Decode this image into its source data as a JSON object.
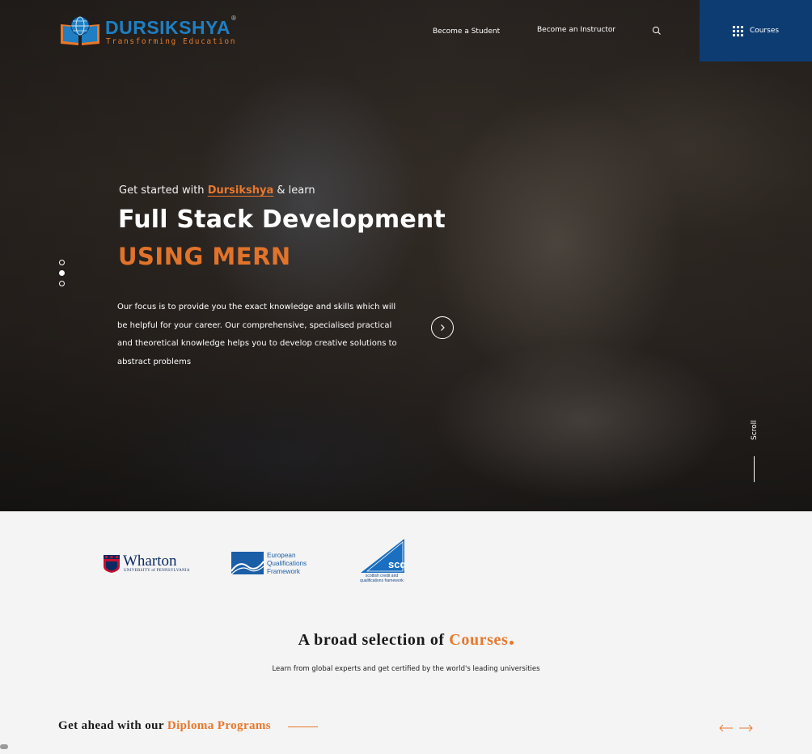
{
  "header": {
    "logo": {
      "name": "DURSIKSHYA",
      "tagline": "Transforming Education",
      "reg_mark": "®"
    },
    "nav": {
      "student": "Become a Student",
      "instructor": "Become an Instructor"
    },
    "courses_button": "Courses"
  },
  "hero": {
    "kicker_prefix": "Get started with",
    "kicker_brand": "Dursikshya",
    "kicker_suffix": "& learn",
    "headline": "Full Stack Development",
    "subhead": "USING MERN",
    "description": "Our focus is to provide you the exact knowledge and skills which will be helpful for your career. Our comprehensive, specialised practical and theoretical knowledge helps you to develop creative solutions to abstract problems",
    "slider": {
      "total": 3,
      "active_index": 1
    },
    "scroll_label": "Scroll"
  },
  "partners": {
    "wharton": {
      "name": "Wharton",
      "sub": "UNIVERSITY of PENNSYLVANIA"
    },
    "eqf": {
      "line1": "European",
      "line2": "Qualifications",
      "line3": "Framework"
    },
    "scqf": {
      "abbr": "scqf",
      "line1": "scottish credit and",
      "line2": "qualifications framework"
    }
  },
  "courses_section": {
    "title_prefix": "A broad selection of",
    "title_accent": "Courses",
    "subtitle": "Learn from global experts and get certified by the world's leading universities"
  },
  "diploma": {
    "prefix": "Get ahead with our",
    "accent": "Diploma Programs"
  },
  "colors": {
    "accent_orange": "#e8782c",
    "brand_blue": "#1f7fc2",
    "courses_button_bg": "#0d3c73"
  }
}
